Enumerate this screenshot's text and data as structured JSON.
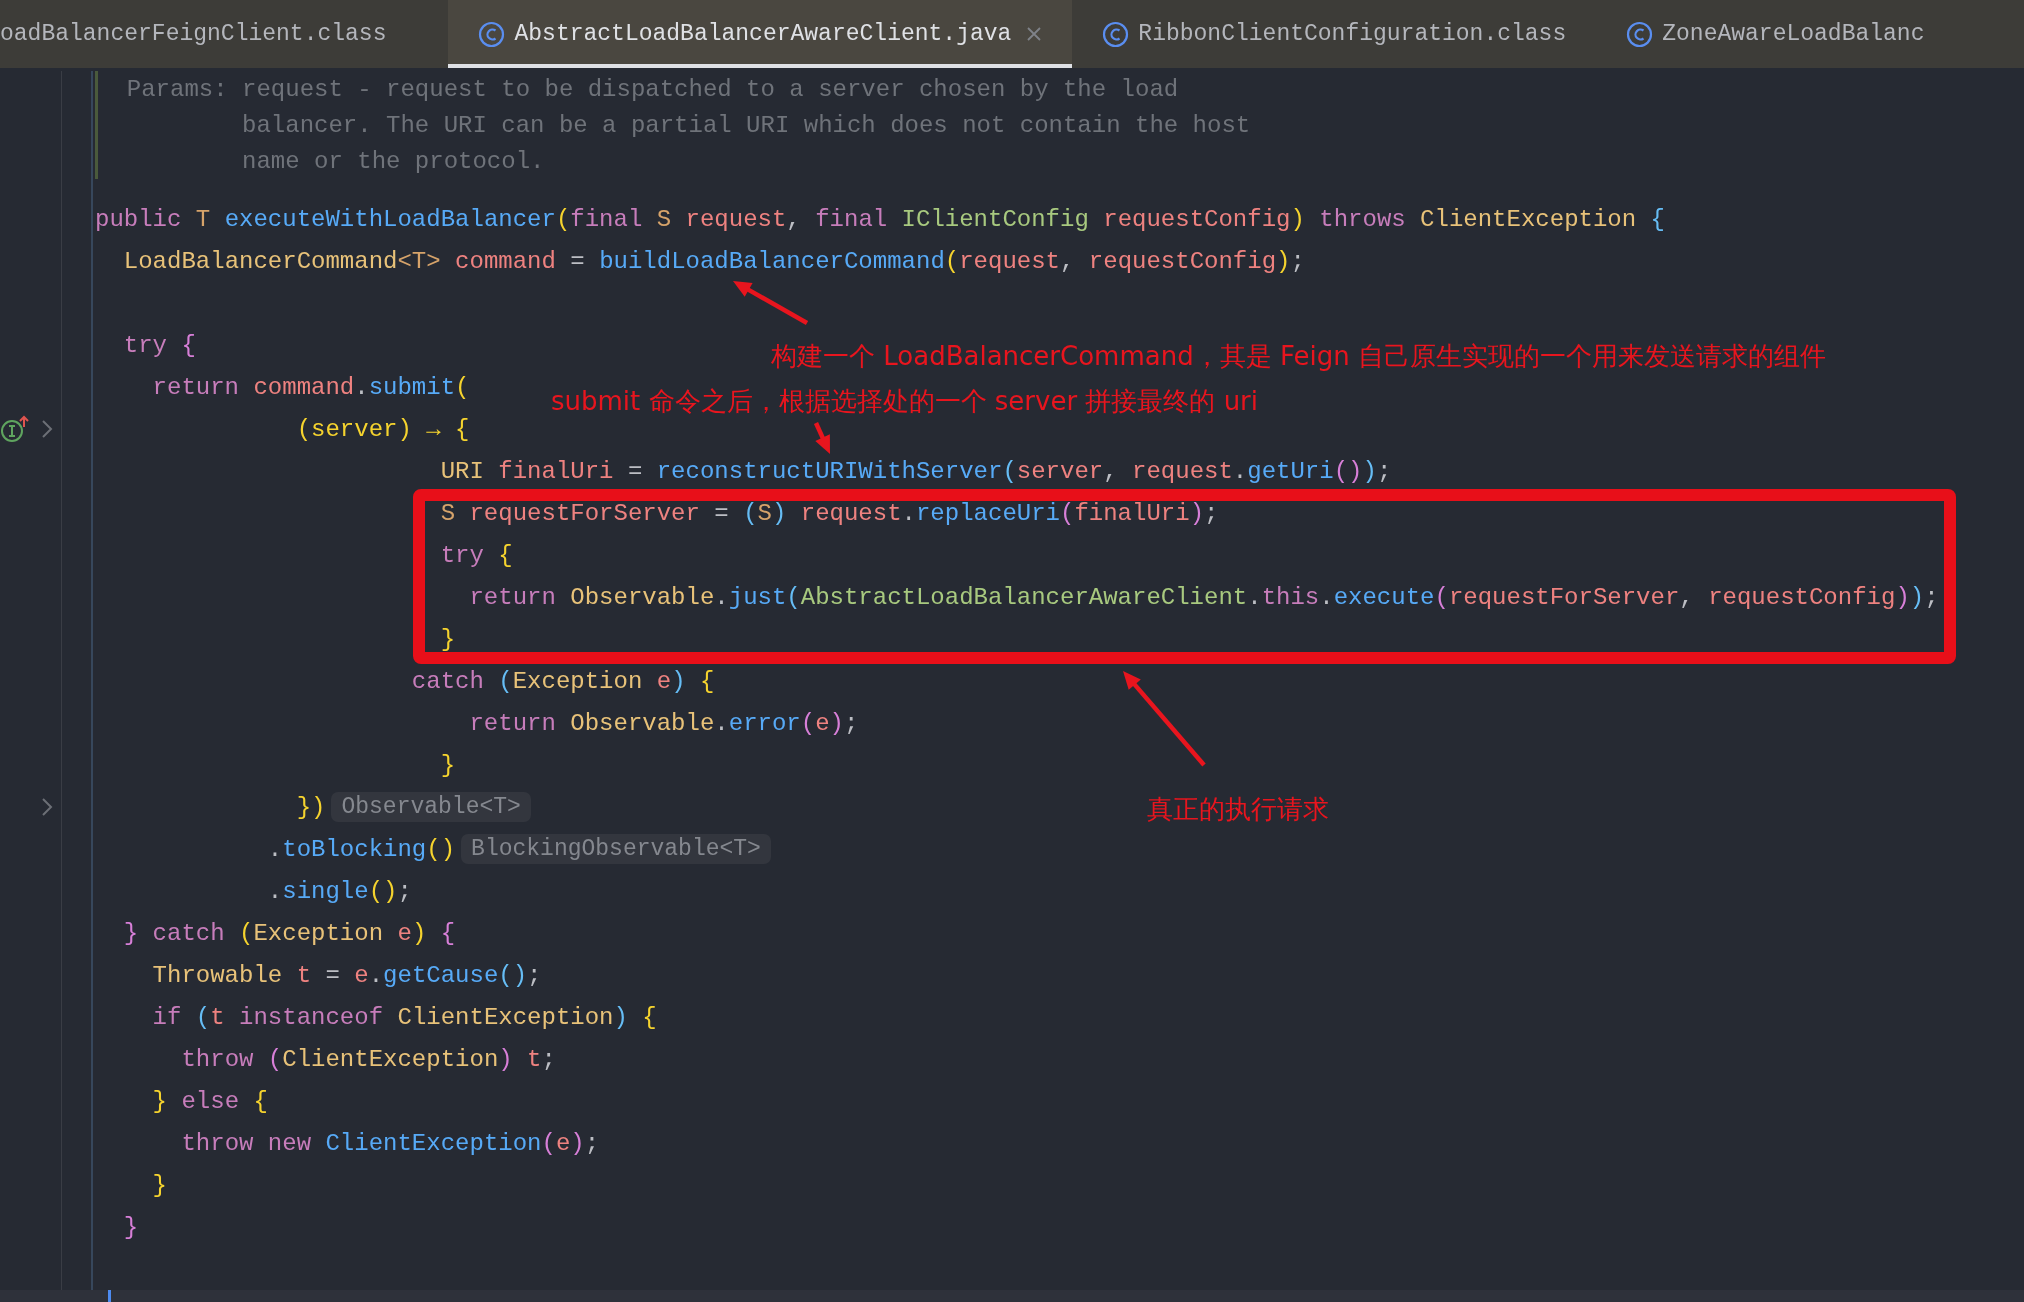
{
  "tabs": [
    {
      "label": "oadBalancerFeignClient.class",
      "selected": false,
      "icon": false
    },
    {
      "label": "AbstractLoadBalancerAwareClient.java",
      "selected": true,
      "icon": true
    },
    {
      "label": "RibbonClientConfiguration.class",
      "selected": false,
      "icon": true
    },
    {
      "label": "ZoneAwareLoadBalanc",
      "selected": false,
      "icon": true
    }
  ],
  "doc": [
    "  Params: request - request to be dispatched to a server chosen by the load",
    "          balancer. The URI can be a partial URI which does not contain the host",
    "          name or the protocol."
  ],
  "lines": [
    {
      "kind": "code",
      "tokens": [
        {
          "t": "public",
          "kind": "kw"
        },
        {
          "t": " T ",
          "kind": "tp"
        },
        {
          "t": "executeWithLoadBalancer",
          "kind": "fn"
        },
        {
          "t": "(",
          "kind": "p1"
        },
        {
          "t": "final",
          "kind": "kw"
        },
        {
          "t": " S",
          "kind": "tp"
        },
        {
          "t": " request",
          "kind": "var"
        },
        {
          "t": ", ",
          "kind": "pu"
        },
        {
          "t": "final",
          "kind": "kw"
        },
        {
          "t": " IClientConfig",
          "kind": "cls"
        },
        {
          "t": " requestConfig",
          "kind": "var"
        },
        {
          "t": ")",
          "kind": "p1"
        },
        {
          "t": " throws",
          "kind": "kw"
        },
        {
          "t": " ClientException",
          "kind": "ty"
        },
        {
          "t": " {",
          "kind": "p3"
        }
      ]
    },
    {
      "kind": "code",
      "tokens": [
        {
          "t": "  LoadBalancerCommand",
          "kind": "ty"
        },
        {
          "t": "<T>",
          "kind": "tp"
        },
        {
          "t": " command",
          "kind": "var"
        },
        {
          "t": " = ",
          "kind": "pu"
        },
        {
          "t": "buildLoadBalancerCommand",
          "kind": "fn"
        },
        {
          "t": "(",
          "kind": "p1"
        },
        {
          "t": "request",
          "kind": "var"
        },
        {
          "t": ", ",
          "kind": "pu"
        },
        {
          "t": "requestConfig",
          "kind": "var"
        },
        {
          "t": ")",
          "kind": "p1"
        },
        {
          "t": ";",
          "kind": "pu"
        }
      ]
    },
    {
      "kind": "blank"
    },
    {
      "kind": "code",
      "tokens": [
        {
          "t": "  try",
          "kind": "kw"
        },
        {
          "t": " {",
          "kind": "p2"
        }
      ]
    },
    {
      "kind": "code",
      "tokens": [
        {
          "t": "    return",
          "kind": "kw"
        },
        {
          "t": " command",
          "kind": "var"
        },
        {
          "t": ".",
          "kind": "pu"
        },
        {
          "t": "submit",
          "kind": "fn"
        },
        {
          "t": "(",
          "kind": "p1"
        }
      ]
    },
    {
      "kind": "implements",
      "tokens": [
        {
          "t": "              (server) → {",
          "kind": "p1"
        }
      ]
    },
    {
      "kind": "code",
      "tokens": [
        {
          "t": "                        URI",
          "kind": "ty"
        },
        {
          "t": " finalUri",
          "kind": "var"
        },
        {
          "t": " = ",
          "kind": "pu"
        },
        {
          "t": "reconstructURIWithServer",
          "kind": "fn"
        },
        {
          "t": "(",
          "kind": "p3"
        },
        {
          "t": "server",
          "kind": "var"
        },
        {
          "t": ", ",
          "kind": "pu"
        },
        {
          "t": "request",
          "kind": "var"
        },
        {
          "t": ".",
          "kind": "pu"
        },
        {
          "t": "getUri",
          "kind": "fn"
        },
        {
          "t": "()",
          "kind": "p2"
        },
        {
          "t": ")",
          "kind": "p3"
        },
        {
          "t": ";",
          "kind": "pu"
        }
      ]
    },
    {
      "kind": "code",
      "tokens": [
        {
          "t": "                        S",
          "kind": "tp"
        },
        {
          "t": " requestForServer",
          "kind": "var"
        },
        {
          "t": " = ",
          "kind": "pu"
        },
        {
          "t": "(",
          "kind": "p3"
        },
        {
          "t": "S",
          "kind": "tp"
        },
        {
          "t": ")",
          "kind": "p3"
        },
        {
          "t": " request",
          "kind": "var"
        },
        {
          "t": ".",
          "kind": "pu"
        },
        {
          "t": "replaceUri",
          "kind": "fn"
        },
        {
          "t": "(",
          "kind": "p2"
        },
        {
          "t": "finalUri",
          "kind": "var"
        },
        {
          "t": ")",
          "kind": "p2"
        },
        {
          "t": ";",
          "kind": "pu"
        }
      ]
    },
    {
      "kind": "code",
      "tokens": [
        {
          "t": "                        try",
          "kind": "kw"
        },
        {
          "t": " {",
          "kind": "p1"
        }
      ]
    },
    {
      "kind": "code",
      "tokens": [
        {
          "t": "                          return",
          "kind": "kw"
        },
        {
          "t": " Observable",
          "kind": "ty"
        },
        {
          "t": ".",
          "kind": "pu"
        },
        {
          "t": "just",
          "kind": "fn"
        },
        {
          "t": "(",
          "kind": "p3"
        },
        {
          "t": "AbstractLoadBalancerAwareClient",
          "kind": "cls"
        },
        {
          "t": ".",
          "kind": "pu"
        },
        {
          "t": "this",
          "kind": "kw"
        },
        {
          "t": ".",
          "kind": "pu"
        },
        {
          "t": "execute",
          "kind": "fn"
        },
        {
          "t": "(",
          "kind": "p2"
        },
        {
          "t": "requestForServer",
          "kind": "var"
        },
        {
          "t": ", ",
          "kind": "pu"
        },
        {
          "t": "requestConfig",
          "kind": "var"
        },
        {
          "t": ")",
          "kind": "p2"
        },
        {
          "t": ")",
          "kind": "p3"
        },
        {
          "t": ";",
          "kind": "pu"
        }
      ]
    },
    {
      "kind": "code",
      "tokens": [
        {
          "t": "                        }",
          "kind": "p1"
        }
      ]
    },
    {
      "kind": "code",
      "tokens": [
        {
          "t": "                      catch",
          "kind": "kw"
        },
        {
          "t": " (",
          "kind": "p3"
        },
        {
          "t": "Exception",
          "kind": "ty"
        },
        {
          "t": " e",
          "kind": "var"
        },
        {
          "t": ")",
          "kind": "p3"
        },
        {
          "t": " {",
          "kind": "p1"
        }
      ]
    },
    {
      "kind": "code",
      "tokens": [
        {
          "t": "                          return",
          "kind": "kw"
        },
        {
          "t": " Observable",
          "kind": "ty"
        },
        {
          "t": ".",
          "kind": "pu"
        },
        {
          "t": "error",
          "kind": "fn"
        },
        {
          "t": "(",
          "kind": "p2"
        },
        {
          "t": "e",
          "kind": "var"
        },
        {
          "t": ")",
          "kind": "p2"
        },
        {
          "t": ";",
          "kind": "pu"
        }
      ]
    },
    {
      "kind": "code",
      "tokens": [
        {
          "t": "                        }",
          "kind": "p1"
        }
      ]
    },
    {
      "kind": "fold",
      "hint": "Observable<T>",
      "tokens": [
        {
          "t": "              })",
          "kind": "p1"
        }
      ]
    },
    {
      "kind": "code",
      "hint": "BlockingObservable<T>",
      "tokens": [
        {
          "t": "            .",
          "kind": "pu"
        },
        {
          "t": "toBlocking",
          "kind": "fn"
        },
        {
          "t": "()",
          "kind": "p1"
        }
      ]
    },
    {
      "kind": "code",
      "tokens": [
        {
          "t": "            .",
          "kind": "pu"
        },
        {
          "t": "single",
          "kind": "fn"
        },
        {
          "t": "()",
          "kind": "p1"
        },
        {
          "t": ";",
          "kind": "pu"
        }
      ]
    },
    {
      "kind": "code",
      "tokens": [
        {
          "t": "  }",
          "kind": "p2"
        },
        {
          "t": " catch",
          "kind": "kw"
        },
        {
          "t": " (",
          "kind": "p1"
        },
        {
          "t": "Exception",
          "kind": "ty"
        },
        {
          "t": " e",
          "kind": "var"
        },
        {
          "t": ")",
          "kind": "p1"
        },
        {
          "t": " {",
          "kind": "p2"
        }
      ]
    },
    {
      "kind": "code",
      "tokens": [
        {
          "t": "    Throwable",
          "kind": "ty"
        },
        {
          "t": " t",
          "kind": "var"
        },
        {
          "t": " = ",
          "kind": "pu"
        },
        {
          "t": "e",
          "kind": "var"
        },
        {
          "t": ".",
          "kind": "pu"
        },
        {
          "t": "getCause",
          "kind": "fn"
        },
        {
          "t": "()",
          "kind": "p3"
        },
        {
          "t": ";",
          "kind": "pu"
        }
      ]
    },
    {
      "kind": "code",
      "tokens": [
        {
          "t": "    if",
          "kind": "kw"
        },
        {
          "t": " (",
          "kind": "p3"
        },
        {
          "t": "t",
          "kind": "var"
        },
        {
          "t": " instanceof",
          "kind": "kw"
        },
        {
          "t": " ClientException",
          "kind": "ty"
        },
        {
          "t": ")",
          "kind": "p3"
        },
        {
          "t": " {",
          "kind": "p1"
        }
      ]
    },
    {
      "kind": "code",
      "tokens": [
        {
          "t": "      throw",
          "kind": "kw"
        },
        {
          "t": " (",
          "kind": "p2"
        },
        {
          "t": "ClientException",
          "kind": "ty"
        },
        {
          "t": ")",
          "kind": "p2"
        },
        {
          "t": " t",
          "kind": "var"
        },
        {
          "t": ";",
          "kind": "pu"
        }
      ]
    },
    {
      "kind": "code",
      "tokens": [
        {
          "t": "    }",
          "kind": "p1"
        },
        {
          "t": " else",
          "kind": "kw"
        },
        {
          "t": " {",
          "kind": "p1"
        }
      ]
    },
    {
      "kind": "code",
      "tokens": [
        {
          "t": "      throw",
          "kind": "kw"
        },
        {
          "t": " new",
          "kind": "kw"
        },
        {
          "t": " ClientException",
          "kind": "fn"
        },
        {
          "t": "(",
          "kind": "p2"
        },
        {
          "t": "e",
          "kind": "var"
        },
        {
          "t": ")",
          "kind": "p2"
        },
        {
          "t": ";",
          "kind": "pu"
        }
      ]
    },
    {
      "kind": "code",
      "tokens": [
        {
          "t": "    }",
          "kind": "p1"
        }
      ]
    },
    {
      "kind": "code",
      "tokens": [
        {
          "t": "  }",
          "kind": "p2"
        }
      ]
    },
    {
      "kind": "blank"
    }
  ],
  "annotations": [
    "构建一个 LoadBalancerCommand，其是 Feign 自己原生实现的一个用来发送请求的组件",
    "submit 命令之后，根据选择处的一个 server 拼接最终的 uri",
    "真正的执行请求"
  ]
}
